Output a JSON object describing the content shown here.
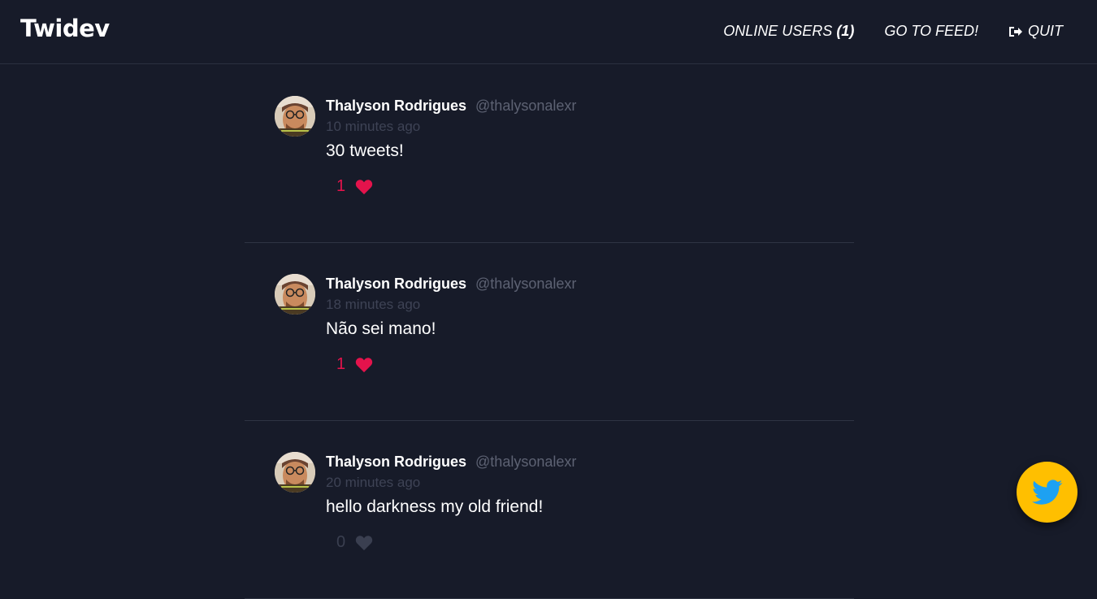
{
  "header": {
    "brand": "Twidev",
    "online_users_label": "ONLINE USERS",
    "online_users_count": "(1)",
    "feed_label": "GO TO FEED!",
    "quit_label": "QUIT"
  },
  "tweets": [
    {
      "author": "Thalyson Rodrigues",
      "handle": "@thalysonalexr",
      "time": "10 minutes ago",
      "text": "30 tweets!",
      "likes": "1",
      "liked": true
    },
    {
      "author": "Thalyson Rodrigues",
      "handle": "@thalysonalexr",
      "time": "18 minutes ago",
      "text": "Não sei mano!",
      "likes": "1",
      "liked": true
    },
    {
      "author": "Thalyson Rodrigues",
      "handle": "@thalysonalexr",
      "time": "20 minutes ago",
      "text": "hello darkness my old friend!",
      "likes": "0",
      "liked": false
    }
  ],
  "colors": {
    "background": "#171b29",
    "like_active": "#e4134c",
    "fab": "#ffbf00",
    "twitter_blue": "#1da1f2"
  },
  "icons": {
    "quit": "sign-out-icon",
    "like": "heart-icon",
    "fab": "twitter-bird-icon"
  }
}
